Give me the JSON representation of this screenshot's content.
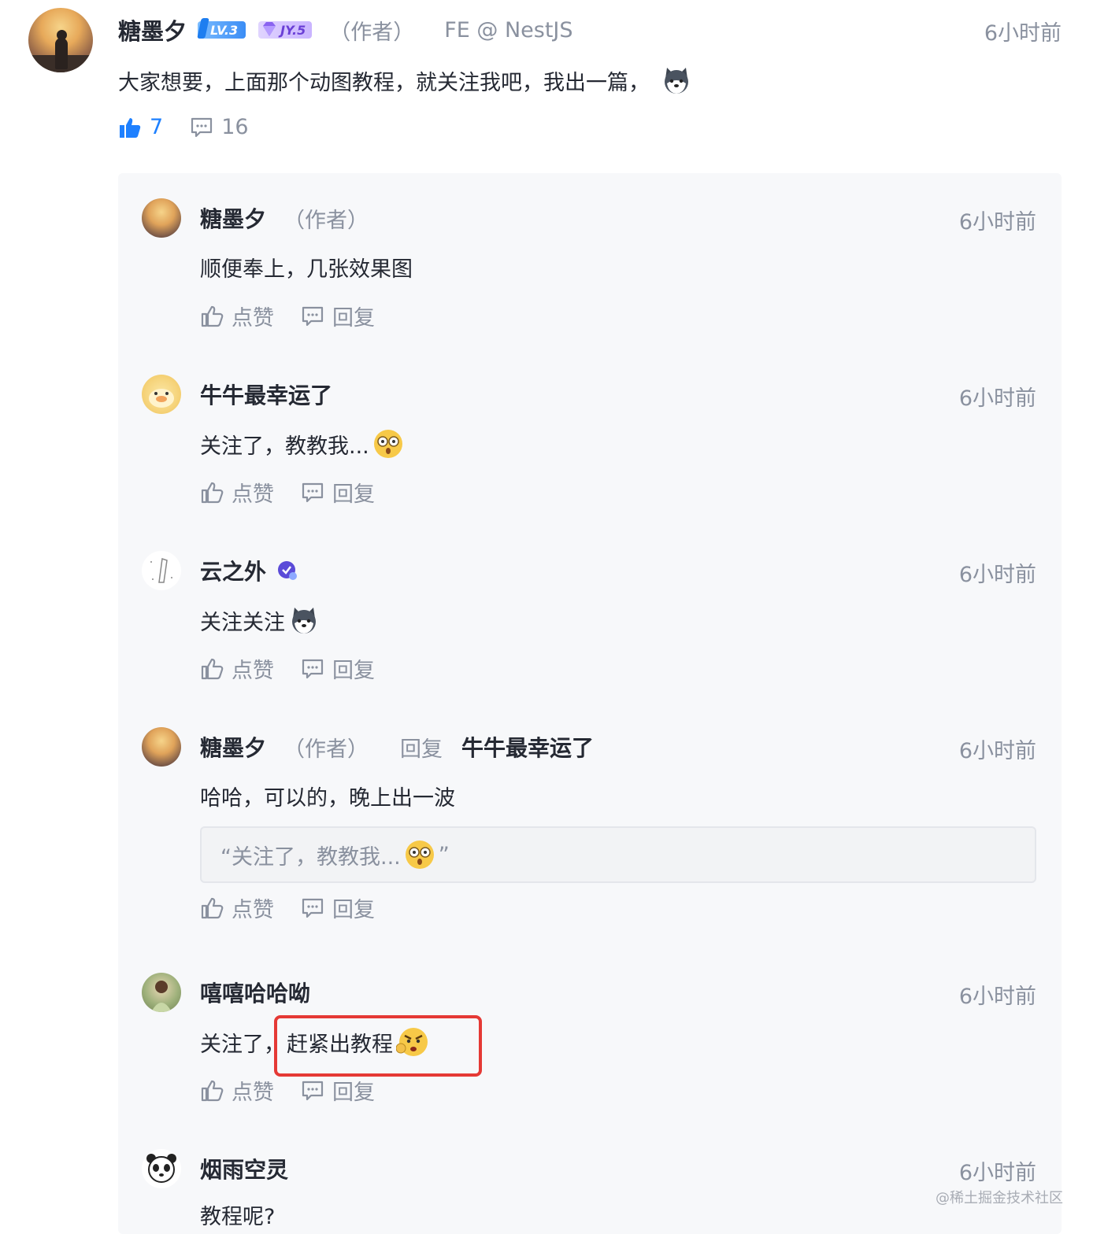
{
  "root": {
    "username": "糖墨夕",
    "level_badge": "LV.3",
    "jy_badge": "JY.5",
    "author_tag": "（作者）",
    "job": "FE @ NestJS",
    "time": "6小时前",
    "text": "大家想要，上面那个动图教程，就关注我吧，我出一篇，",
    "emoji": "husky-emoji",
    "like_count": "7",
    "reply_count": "16"
  },
  "replies": [
    {
      "username": "糖墨夕",
      "author_tag": "（作者）",
      "time": "6小时前",
      "text": "顺便奉上，几张效果图",
      "like_label": "点赞",
      "reply_label": "回复"
    },
    {
      "username": "牛牛最幸运了",
      "time": "6小时前",
      "text": "关注了，教教我...",
      "emoji": "dazed-emoji",
      "like_label": "点赞",
      "reply_label": "回复"
    },
    {
      "username": "云之外",
      "time": "6小时前",
      "text": "关注关注",
      "emoji": "husky-emoji",
      "like_label": "点赞",
      "reply_label": "回复"
    },
    {
      "username": "糖墨夕",
      "author_tag": "（作者）",
      "reply_word": "回复",
      "reply_target": "牛牛最幸运了",
      "time": "6小时前",
      "text": "哈哈，可以的，晚上出一波",
      "quote_open": "“关注了，教教我...",
      "quote_close": "”",
      "like_label": "点赞",
      "reply_label": "回复"
    },
    {
      "username": "嘻嘻哈哈呦",
      "time": "6小时前",
      "text_a": "关注了，",
      "text_b": "赶紧出教程",
      "emoji": "angry-emoji",
      "like_label": "点赞",
      "reply_label": "回复"
    },
    {
      "username": "烟雨空灵",
      "time": "6小时前",
      "text": "教程呢?"
    }
  ],
  "watermark": "@稀土掘金技术社区",
  "colors": {
    "accent": "#1e80ff",
    "highlight_border": "#e53935",
    "muted": "#8a919f"
  }
}
